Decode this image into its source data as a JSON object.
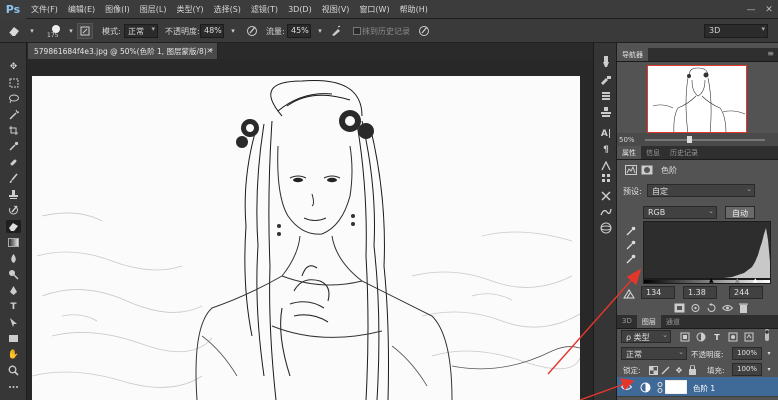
{
  "app": {
    "logo": "Ps"
  },
  "menu": [
    "文件(F)",
    "编辑(E)",
    "图像(I)",
    "图层(L)",
    "类型(Y)",
    "选择(S)",
    "滤镜(T)",
    "3D(D)",
    "视图(V)",
    "窗口(W)",
    "帮助(H)"
  ],
  "window_controls": {
    "minimize": "—",
    "close": "✕"
  },
  "options_bar": {
    "brush_size": "175",
    "mode_label": "模式:",
    "mode_value": "正常",
    "opacity_label": "不透明度:",
    "opacity_value": "48%",
    "flow_label": "流量:",
    "flow_value": "45%",
    "history_label": "抹到历史记录",
    "workspace": "3D"
  },
  "document": {
    "tab_title": "579861684f4e3.jpg @ 50%(色阶 1, 图层蒙版/8) *",
    "close": "×"
  },
  "navigator": {
    "tabs": [
      "导航器"
    ],
    "zoom": "50%"
  },
  "properties": {
    "tabs": [
      "属性",
      "信息",
      "历史记录"
    ],
    "adjust_name": "色阶",
    "preset_label": "预设:",
    "preset_value": "自定",
    "channel_value": "RGB",
    "auto_label": "自动",
    "input_black": "134",
    "input_gamma": "1.38",
    "input_white": "244"
  },
  "layers": {
    "tabs": [
      "3D",
      "图层",
      "通道"
    ],
    "filter_label": "ρ 类型",
    "blend_mode": "正常",
    "opacity_label": "不透明度:",
    "opacity_value": "100%",
    "lock_label": "锁定:",
    "fill_label": "填充:",
    "fill_value": "100%",
    "rows": [
      {
        "name": "色阶 1"
      }
    ]
  },
  "colors": {
    "accent_red": "#e4372b",
    "selected_layer": "#3f6a98"
  }
}
